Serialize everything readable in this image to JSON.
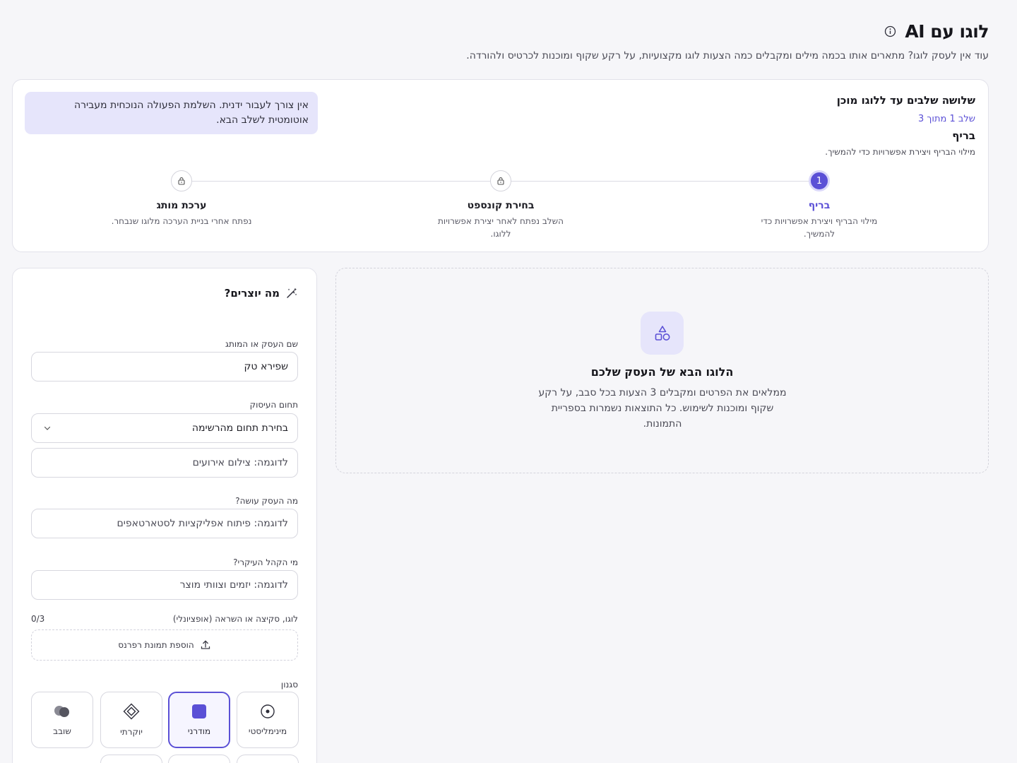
{
  "header": {
    "title": "לוגו עם AI",
    "subtitle": "עוד אין לעסק לוגו? מתארים אותו בכמה מילים ומקבלים כמה הצעות לוגו מקצועיות, על רקע שקוף ומוכנות לכרטיס ולהורדה."
  },
  "steps": {
    "heading": "שלושה שלבים עד ללוגו מוכן",
    "count": "שלב 1 מתוך 3",
    "current_name": "בריף",
    "current_desc": "מילוי הבריף ויצירת אפשרויות כדי להמשיך.",
    "auto_note": "אין צורך לעבור ידנית. השלמת הפעולה הנוכחית מעבירה אוטומטית לשלב הבא.",
    "items": [
      {
        "number": "1",
        "label": "בריף",
        "desc": "מילוי הבריף ויצירת אפשרויות כדי להמשיך.",
        "state": "active"
      },
      {
        "number": "",
        "label": "בחירת קונספט",
        "desc": "השלב נפתח לאחר יצירת אפשרויות ללוגו.",
        "state": "locked"
      },
      {
        "number": "",
        "label": "ערכת מותג",
        "desc": "נפתח אחרי בניית הערכה מלוגו שנבחר.",
        "state": "locked"
      }
    ]
  },
  "form": {
    "heading": "מה יוצרים?",
    "business_name_label": "שם העסק או המותג",
    "business_name_value": "שפירא טק",
    "field_label": "תחום העיסוק",
    "field_select": "בחירת תחום מהרשימה",
    "field_other_placeholder": "לדוגמה: צילום אירועים",
    "what_label": "מה העסק עושה?",
    "what_placeholder": "לדוגמה: פיתוח אפליקציות לסטארטאפים",
    "audience_label": "מי הקהל העיקרי?",
    "audience_placeholder": "לדוגמה: יזמים וצוותי מוצר",
    "reference_label": "לוגו, סקיצה או השראה (אופציונלי)",
    "reference_counter": "0/3",
    "upload_label": "הוספת תמונת רפרנס",
    "style_label": "סגנון",
    "styles": [
      {
        "label": "מינימליסטי",
        "icon": "target-icon",
        "selected": false
      },
      {
        "label": "מודרני",
        "icon": "square-icon",
        "selected": true
      },
      {
        "label": "יוקרתי",
        "icon": "diamond-icon",
        "selected": false
      },
      {
        "label": "שובב",
        "icon": "toggle-dots-icon",
        "selected": false
      }
    ]
  },
  "preview": {
    "title": "הלוגו הבא של העסק שלכם",
    "desc": "ממלאים את הפרטים ומקבלים 3 הצעות בכל סבב, על רקע שקוף ומוכנות לשימוש. כל התוצאות נשמרות בספריית התמונות."
  },
  "colors": {
    "accent": "#5b50d6",
    "accent_soft": "#e6e5fb",
    "background": "#f6f6f9"
  }
}
